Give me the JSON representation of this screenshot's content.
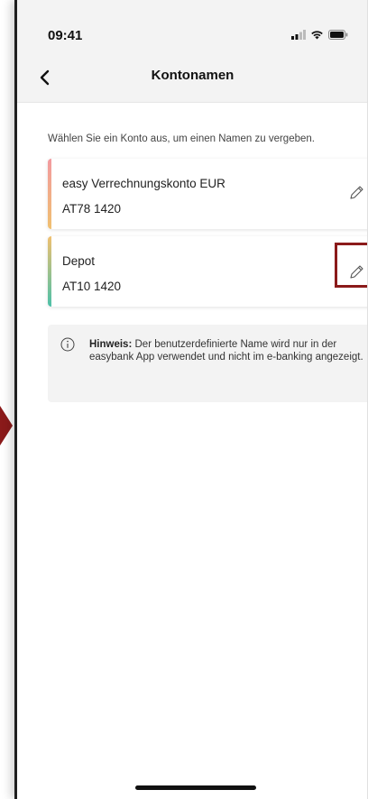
{
  "status_bar": {
    "time": "09:41"
  },
  "nav": {
    "title": "Kontonamen"
  },
  "instruction": "Wählen Sie ein Konto aus, um einen Namen zu vergeben.",
  "accounts": [
    {
      "name": "easy Verrechnungskonto EUR",
      "iban": "AT78 1420",
      "accent_color": "#f0b060"
    },
    {
      "name": "Depot",
      "iban": "AT10 1420",
      "accent_color": "#4cc0a8"
    }
  ],
  "hint": {
    "label": "Hinweis:",
    "text": "Der benutzerdefinierte Name wird nur in der easybank App verwendet und nicht im e-banking angezeigt."
  },
  "colors": {
    "highlight": "#8b1a1a",
    "panel_bg": "#f3f3f3"
  }
}
